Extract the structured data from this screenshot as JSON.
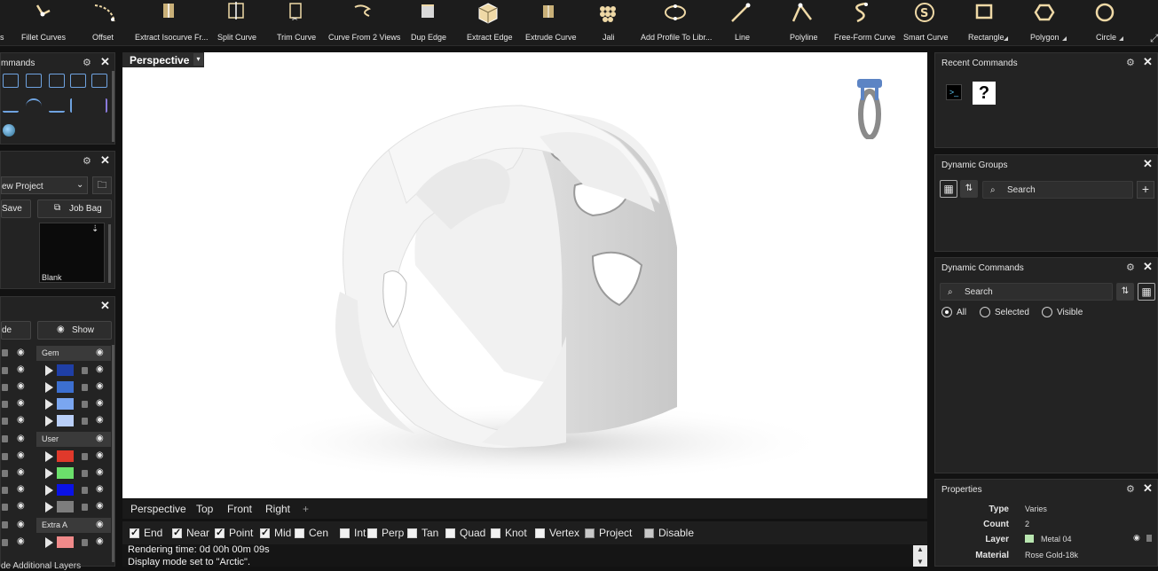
{
  "toolbar": {
    "tools": [
      {
        "label": "s",
        "icon": "fillet-icon"
      },
      {
        "label": "Fillet Curves",
        "icon": "fillet-curves-icon"
      },
      {
        "label": "Offset",
        "icon": "offset-icon"
      },
      {
        "label": "Extract Isocurve Fr...",
        "icon": "extract-isocurve-icon"
      },
      {
        "label": "Split Curve",
        "icon": "split-curve-icon"
      },
      {
        "label": "Trim Curve",
        "icon": "trim-curve-icon"
      },
      {
        "label": "Curve From 2 Views",
        "icon": "curve-from-2-views-icon"
      },
      {
        "label": "Dup Edge",
        "icon": "dup-edge-icon"
      },
      {
        "label": "Extract Edge",
        "icon": "extract-edge-icon"
      },
      {
        "label": "Extrude Curve",
        "icon": "extrude-curve-icon"
      },
      {
        "label": "Jali",
        "icon": "jali-icon"
      },
      {
        "label": "Add Profile To Libr...",
        "icon": "add-profile-icon"
      },
      {
        "label": "Line",
        "icon": "line-icon"
      },
      {
        "label": "Polyline",
        "icon": "polyline-icon"
      },
      {
        "label": "Free-Form Curve",
        "icon": "free-form-curve-icon"
      },
      {
        "label": "Smart Curve",
        "icon": "smart-curve-icon"
      },
      {
        "label": "Rectangle",
        "icon": "rectangle-icon"
      },
      {
        "label": "Polygon",
        "icon": "polygon-icon"
      },
      {
        "label": "Circle",
        "icon": "circle-icon"
      }
    ]
  },
  "left_panels": {
    "commands_title": "mmands",
    "project_select": "ew Project",
    "save_label": "Save",
    "jobbag_label": "Job Bag",
    "thumb_label": "Blank",
    "layers": {
      "hide_label": "de",
      "show_label": "Show",
      "groups": [
        {
          "name": "Gem",
          "colors": [
            "#1f3fa6",
            "#3c6fd0",
            "#7aa6f0",
            "#b9cff8"
          ]
        },
        {
          "name": "User",
          "colors": [
            "#e0392b",
            "#6be06b",
            "#0a12e6",
            "#7d7d7d"
          ]
        },
        {
          "name": "Extra A",
          "colors": [
            "#f08a8a"
          ]
        }
      ],
      "footer": "de Additional Layers"
    }
  },
  "viewport": {
    "name": "Perspective",
    "tabs": [
      "Perspective",
      "Top",
      "Front",
      "Right"
    ],
    "add_tab": "+"
  },
  "osnaps": [
    {
      "label": "End",
      "checked": true
    },
    {
      "label": "Near",
      "checked": true
    },
    {
      "label": "Point",
      "checked": true
    },
    {
      "label": "Mid",
      "checked": true
    },
    {
      "label": "Cen",
      "checked": false
    },
    {
      "label": "Int",
      "checked": false
    },
    {
      "label": "Perp",
      "checked": false
    },
    {
      "label": "Tan",
      "checked": false
    },
    {
      "label": "Quad",
      "checked": false
    },
    {
      "label": "Knot",
      "checked": false
    },
    {
      "label": "Vertex",
      "checked": false
    },
    {
      "label": "Project",
      "checked": false,
      "dim": true
    },
    {
      "label": "Disable",
      "checked": false,
      "dim": true
    }
  ],
  "command_log": [
    "Rendering time: 0d 00h 00m 09s",
    "Display mode set to \"Arctic\"."
  ],
  "right_panels": {
    "recent_title": "Recent Commands",
    "dyn_groups_title": "Dynamic Groups",
    "dyn_groups_search": "Search",
    "dyn_cmds_title": "Dynamic Commands",
    "dyn_cmds_search": "Search",
    "filters": [
      {
        "label": "All",
        "selected": true
      },
      {
        "label": "Selected",
        "selected": false
      },
      {
        "label": "Visible",
        "selected": false
      }
    ],
    "properties_title": "Properties",
    "properties": {
      "type_k": "Type",
      "type_v": "Varies",
      "count_k": "Count",
      "count_v": "2",
      "layer_k": "Layer",
      "layer_v": "Metal 04",
      "material_k": "Material",
      "material_v": "Rose Gold-18k"
    }
  },
  "colors": {
    "accent_blue": "#4aa3ff",
    "tool_icon": "#efd9a6",
    "layer_metal": "#b9e6b0"
  }
}
